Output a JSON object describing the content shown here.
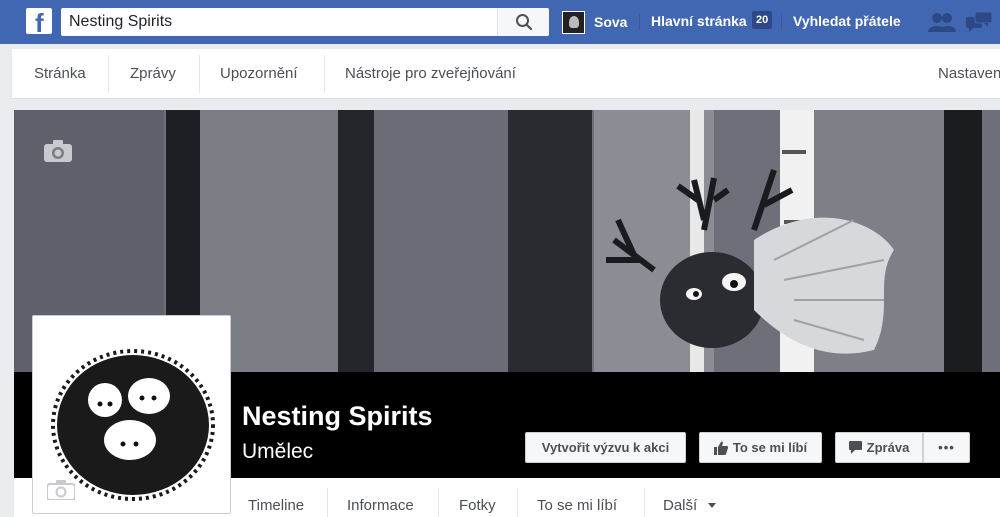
{
  "topbar": {
    "search_value": "Nesting Spirits",
    "user_name": "Sova",
    "home_label": "Hlavní stránka",
    "home_badge": "20",
    "find_friends_label": "Vyhledat přátele"
  },
  "page_nav": {
    "items": [
      "Stránka",
      "Zprávy",
      "Upozornění",
      "Nástroje pro zveřejňování",
      "Nastavení"
    ]
  },
  "page": {
    "title": "Nesting Spirits",
    "category": "Umělec",
    "buttons": {
      "cta": "Vytvořit výzvu k akci",
      "like": "To se mi líbí",
      "message": "Zpráva",
      "more": "•••"
    },
    "tabs": [
      "Timeline",
      "Informace",
      "Fotky",
      "To se mi líbí",
      "Další"
    ]
  },
  "colors": {
    "brand": "#4267b2",
    "cover_band": "#000000"
  },
  "icons": [
    "facebook-logo-icon",
    "search-icon",
    "friend-requests-icon",
    "messages-icon",
    "camera-icon",
    "thumbs-up-icon",
    "message-icon",
    "dropdown-arrow-icon"
  ]
}
